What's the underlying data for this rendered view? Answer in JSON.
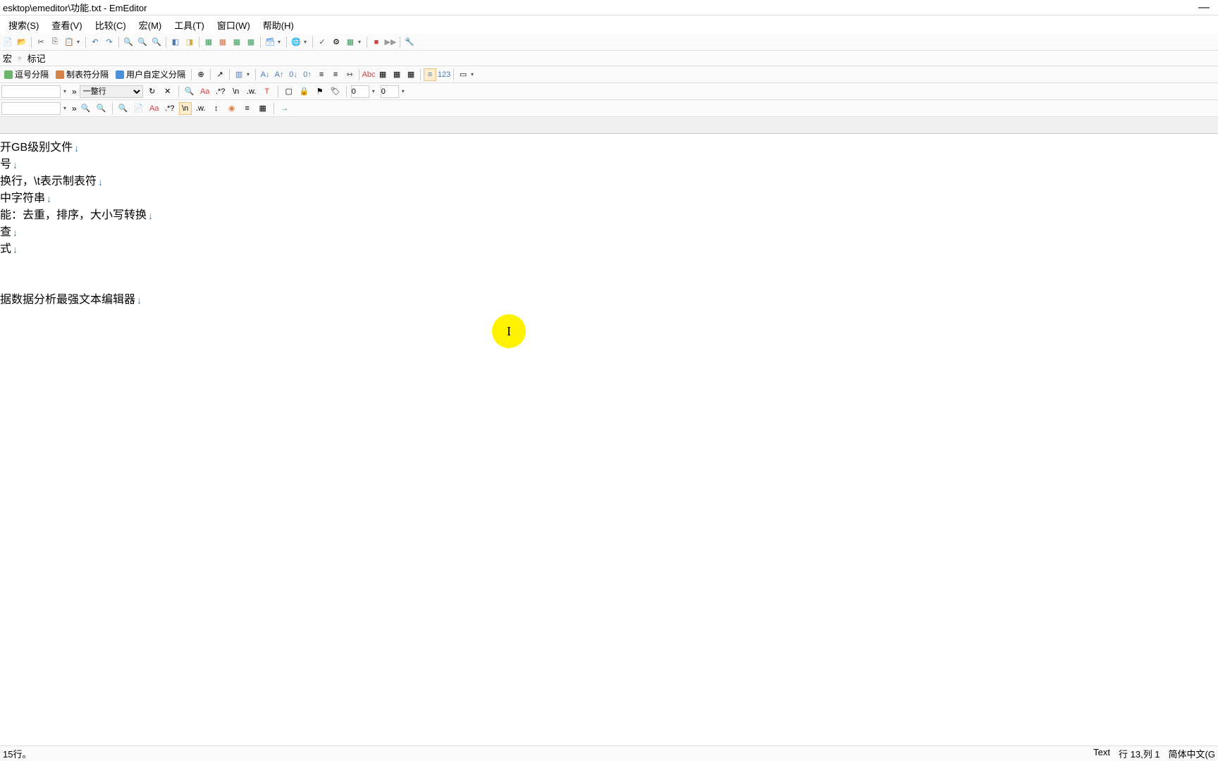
{
  "window": {
    "title": "esktop\\emeditor\\功能.txt - EmEditor"
  },
  "menus": {
    "search": "搜索(S)",
    "view": "查看(V)",
    "compare": "比较(C)",
    "macro": "宏(M)",
    "tools": "工具(T)",
    "window": "窗口(W)",
    "help": "帮助(H)"
  },
  "macroBar": {
    "macro": "宏",
    "markers": "标记"
  },
  "toolbar2": {
    "commaSep": "逗号分隔",
    "tabSep": "制表符分隔",
    "customSep": "用户自定义分隔"
  },
  "searchBar": {
    "wholeLine": "一整行",
    "zero1": "0",
    "zero2": "0"
  },
  "document": {
    "lines": [
      "开GB级别文件",
      "号",
      "换行，\\t表示制表符",
      "中字符串",
      "能：去重，排序，大小写转换",
      "查",
      "式",
      "",
      "",
      "据数据分析最强文本编辑器"
    ]
  },
  "cursor": {
    "glyph": "I"
  },
  "statusBar": {
    "left": "15行。",
    "text": "Text",
    "position": "行 13,列 1",
    "encoding": "简体中文(G"
  }
}
